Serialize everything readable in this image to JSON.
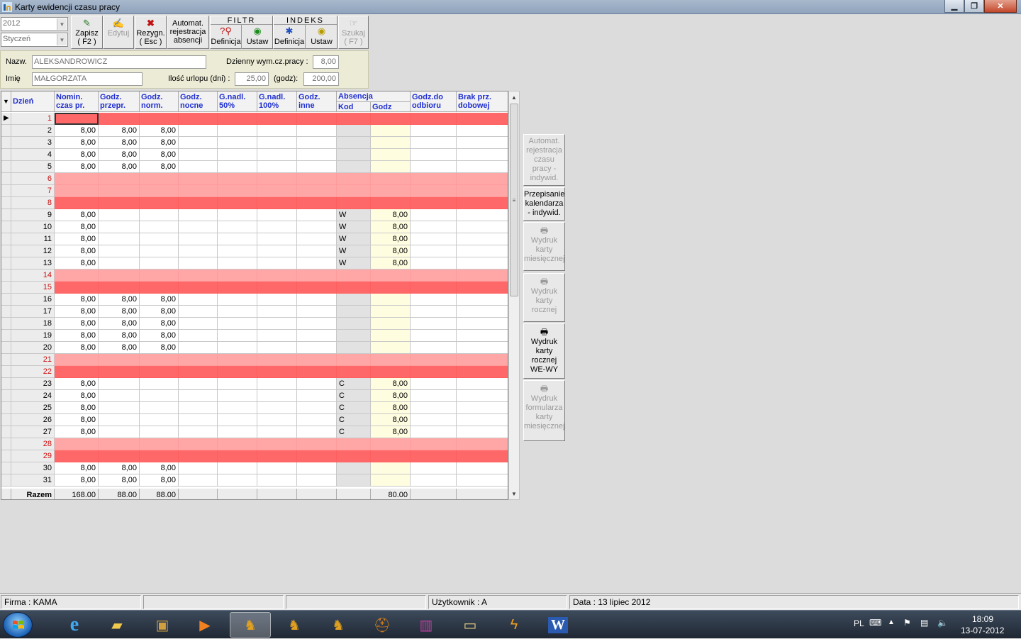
{
  "window": {
    "title": "Karty ewidencji czasu pracy"
  },
  "toolbar": {
    "year": "2012",
    "month": "Styczeń",
    "save": {
      "line1": "Zapisz",
      "line2": "( F2 )"
    },
    "edit": {
      "line1": "Edytuj"
    },
    "cancel": {
      "line1": "Rezygn.",
      "line2": "( Esc )"
    },
    "auto": {
      "line1": "Automat.",
      "line2": "rejestracja",
      "line3": "absencji"
    },
    "filtr": {
      "title": "FILTR",
      "def": "Definicja",
      "set": "Ustaw"
    },
    "indeks": {
      "title": "INDEKS",
      "def": "Definicja",
      "set": "Ustaw"
    },
    "search": {
      "line1": "Szukaj",
      "line2": "( F7 )"
    }
  },
  "employee": {
    "surname_label": "Nazw.",
    "surname": "ALEKSANDROWICZ",
    "firstname_label": "Imię",
    "firstname": "MAŁGORZATA",
    "daily_label": "Dzienny wym.cz.pracy :",
    "daily": "8,00",
    "leave_label": "Ilość urlopu (dni) :",
    "leave_days": "25,00",
    "hours_label": "(godz):",
    "leave_hours": "200,00"
  },
  "grid": {
    "headers": {
      "day": "Dzień",
      "nomin": [
        "Nomin.",
        "czas pr."
      ],
      "przepr": [
        "Godz.",
        "przepr."
      ],
      "norm": [
        "Godz.",
        "norm."
      ],
      "nocne": [
        "Godz.",
        "nocne"
      ],
      "g50": [
        "G.nadl.",
        "50%"
      ],
      "g100": [
        "G.nadl.",
        "100%"
      ],
      "inne": [
        "Godz.",
        "inne"
      ],
      "absencja": "Absencja",
      "kod": "Kod",
      "godz": "Godz",
      "odbioru": [
        "Godz.do",
        "odbioru"
      ],
      "brak": [
        "Brak prz.",
        "dobowej"
      ]
    },
    "rows": [
      {
        "d": "1",
        "t": "sun",
        "n": "",
        "p": "",
        "m": "",
        "k": "",
        "g": ""
      },
      {
        "d": "2",
        "t": "",
        "n": "8,00",
        "p": "8,00",
        "m": "8,00",
        "k": "",
        "g": ""
      },
      {
        "d": "3",
        "t": "",
        "n": "8,00",
        "p": "8,00",
        "m": "8,00",
        "k": "",
        "g": ""
      },
      {
        "d": "4",
        "t": "",
        "n": "8,00",
        "p": "8,00",
        "m": "8,00",
        "k": "",
        "g": ""
      },
      {
        "d": "5",
        "t": "",
        "n": "8,00",
        "p": "8,00",
        "m": "8,00",
        "k": "",
        "g": ""
      },
      {
        "d": "6",
        "t": "hol",
        "n": "",
        "p": "",
        "m": "",
        "k": "",
        "g": ""
      },
      {
        "d": "7",
        "t": "hol",
        "n": "",
        "p": "",
        "m": "",
        "k": "",
        "g": ""
      },
      {
        "d": "8",
        "t": "sun",
        "n": "",
        "p": "",
        "m": "",
        "k": "",
        "g": ""
      },
      {
        "d": "9",
        "t": "",
        "n": "8,00",
        "p": "",
        "m": "",
        "k": "W",
        "g": "8,00"
      },
      {
        "d": "10",
        "t": "",
        "n": "8,00",
        "p": "",
        "m": "",
        "k": "W",
        "g": "8,00"
      },
      {
        "d": "11",
        "t": "",
        "n": "8,00",
        "p": "",
        "m": "",
        "k": "W",
        "g": "8,00"
      },
      {
        "d": "12",
        "t": "",
        "n": "8,00",
        "p": "",
        "m": "",
        "k": "W",
        "g": "8,00"
      },
      {
        "d": "13",
        "t": "",
        "n": "8,00",
        "p": "",
        "m": "",
        "k": "W",
        "g": "8,00"
      },
      {
        "d": "14",
        "t": "hol",
        "n": "",
        "p": "",
        "m": "",
        "k": "",
        "g": ""
      },
      {
        "d": "15",
        "t": "sun",
        "n": "",
        "p": "",
        "m": "",
        "k": "",
        "g": ""
      },
      {
        "d": "16",
        "t": "",
        "n": "8,00",
        "p": "8,00",
        "m": "8,00",
        "k": "",
        "g": ""
      },
      {
        "d": "17",
        "t": "",
        "n": "8,00",
        "p": "8,00",
        "m": "8,00",
        "k": "",
        "g": ""
      },
      {
        "d": "18",
        "t": "",
        "n": "8,00",
        "p": "8,00",
        "m": "8,00",
        "k": "",
        "g": ""
      },
      {
        "d": "19",
        "t": "",
        "n": "8,00",
        "p": "8,00",
        "m": "8,00",
        "k": "",
        "g": ""
      },
      {
        "d": "20",
        "t": "",
        "n": "8,00",
        "p": "8,00",
        "m": "8,00",
        "k": "",
        "g": ""
      },
      {
        "d": "21",
        "t": "hol",
        "n": "",
        "p": "",
        "m": "",
        "k": "",
        "g": ""
      },
      {
        "d": "22",
        "t": "sun",
        "n": "",
        "p": "",
        "m": "",
        "k": "",
        "g": ""
      },
      {
        "d": "23",
        "t": "",
        "n": "8,00",
        "p": "",
        "m": "",
        "k": "C",
        "g": "8,00"
      },
      {
        "d": "24",
        "t": "",
        "n": "8,00",
        "p": "",
        "m": "",
        "k": "C",
        "g": "8,00"
      },
      {
        "d": "25",
        "t": "",
        "n": "8,00",
        "p": "",
        "m": "",
        "k": "C",
        "g": "8,00"
      },
      {
        "d": "26",
        "t": "",
        "n": "8,00",
        "p": "",
        "m": "",
        "k": "C",
        "g": "8,00"
      },
      {
        "d": "27",
        "t": "",
        "n": "8,00",
        "p": "",
        "m": "",
        "k": "C",
        "g": "8,00"
      },
      {
        "d": "28",
        "t": "hol",
        "n": "",
        "p": "",
        "m": "",
        "k": "",
        "g": ""
      },
      {
        "d": "29",
        "t": "sun",
        "n": "",
        "p": "",
        "m": "",
        "k": "",
        "g": ""
      },
      {
        "d": "30",
        "t": "",
        "n": "8,00",
        "p": "8,00",
        "m": "8,00",
        "k": "",
        "g": ""
      },
      {
        "d": "31",
        "t": "",
        "n": "8,00",
        "p": "8,00",
        "m": "8,00",
        "k": "",
        "g": ""
      }
    ],
    "totals": {
      "label": "Razem",
      "nomin": "168.00",
      "przepr": "88.00",
      "norm": "88.00",
      "godz": "80.00"
    }
  },
  "side_buttons": {
    "auto": [
      "Automat.",
      "rejestracja",
      "czasu",
      "pracy -",
      "indywid."
    ],
    "rewrite": [
      "Przepisanie",
      "kalendarza",
      "- indywid."
    ],
    "print_monthly": [
      "Wydruk",
      "karty",
      "miesięcznej"
    ],
    "print_yearly": [
      "Wydruk",
      "karty",
      "rocznej"
    ],
    "print_yearly_wewy": [
      "Wydruk",
      "karty",
      "rocznej",
      "WE-WY"
    ],
    "print_form": [
      "Wydruk",
      "formularza",
      "karty",
      "miesięcznej"
    ]
  },
  "status": {
    "firm": "Firma : KAMA",
    "user": "Użytkownik : A",
    "date": "Data : 13 lipiec 2012"
  },
  "tray": {
    "lang": "PL",
    "time": "18:09",
    "date": "13-07-2012"
  }
}
